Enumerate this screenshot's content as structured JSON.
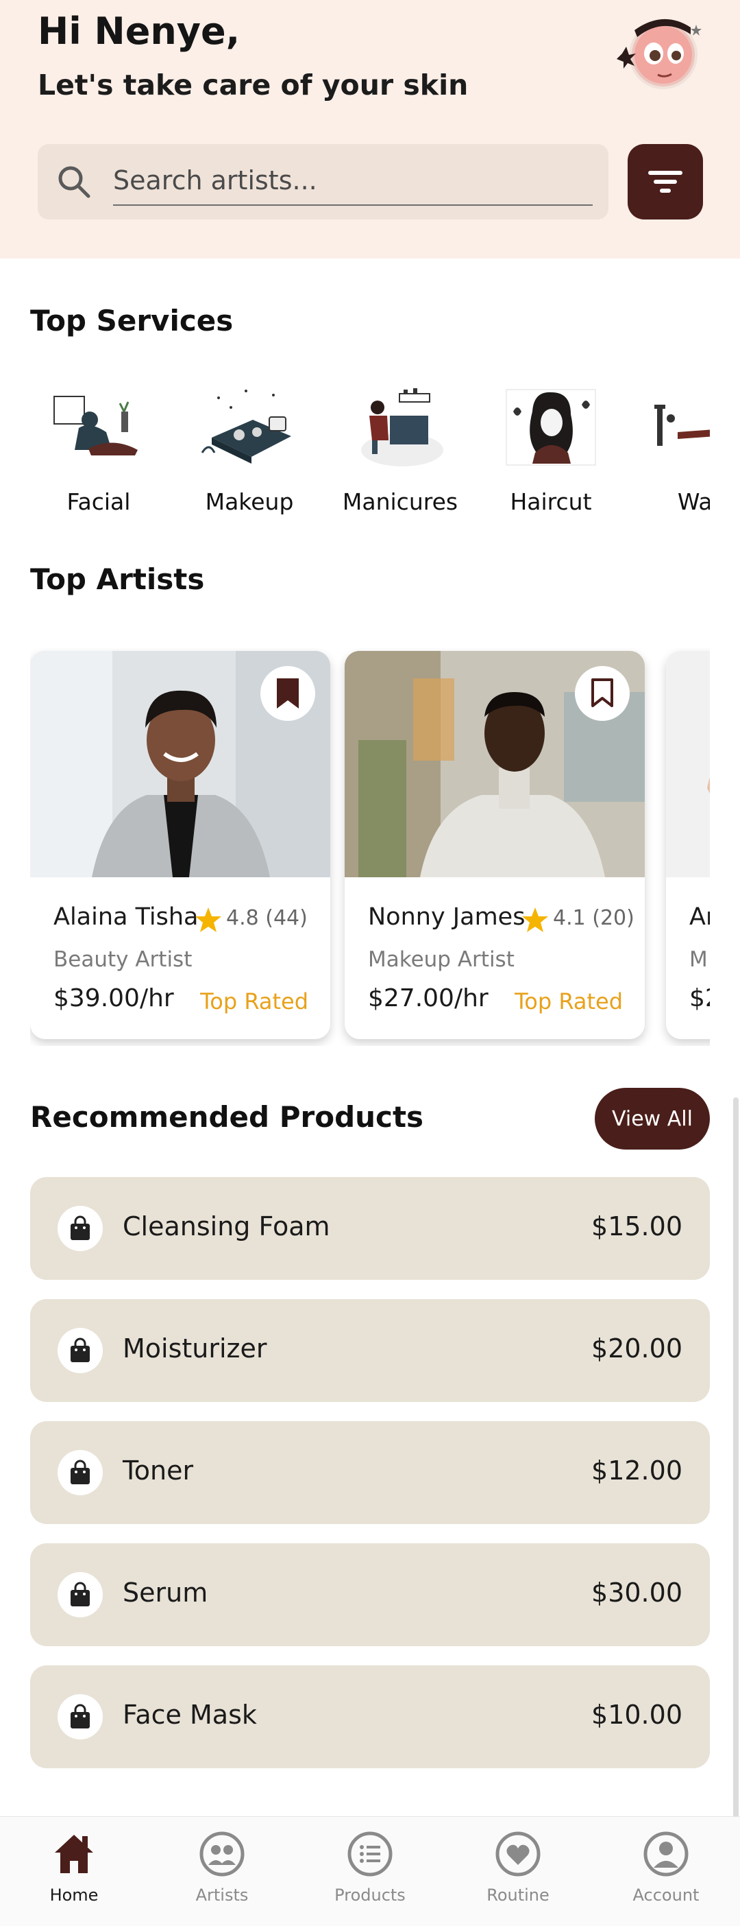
{
  "header": {
    "greeting": "Hi Nenye,",
    "tagline": "Let's take care of your skin",
    "search_placeholder": "Search artists..."
  },
  "services": {
    "title": "Top Services",
    "items": [
      {
        "label": "Facial",
        "icon": "facial-illustration"
      },
      {
        "label": "Makeup",
        "icon": "makeup-illustration"
      },
      {
        "label": "Manicures",
        "icon": "manicure-illustration"
      },
      {
        "label": "Haircut",
        "icon": "haircut-illustration"
      },
      {
        "label": "Wax",
        "icon": "wax-illustration"
      }
    ]
  },
  "artists": {
    "title": "Top Artists",
    "items": [
      {
        "name": "Alaina Tisha",
        "rating": "4.8",
        "reviews": "(44)",
        "role": "Beauty Artist",
        "price": "$39.00/hr",
        "badge": "Top Rated",
        "bookmarked": true
      },
      {
        "name": "Nonny James",
        "rating": "4.1",
        "reviews": "(20)",
        "role": "Makeup Artist",
        "price": "$27.00/hr",
        "badge": "Top Rated",
        "bookmarked": false
      },
      {
        "name": "Ar",
        "role": "M",
        "price": "$2"
      }
    ]
  },
  "products": {
    "title": "Recommended Products",
    "view_all": "View All",
    "items": [
      {
        "name": "Cleansing Foam",
        "price": "$15.00"
      },
      {
        "name": "Moisturizer",
        "price": "$20.00"
      },
      {
        "name": "Toner",
        "price": "$12.00"
      },
      {
        "name": "Serum",
        "price": "$30.00"
      },
      {
        "name": "Face Mask",
        "price": "$10.00"
      }
    ]
  },
  "nav": {
    "items": [
      {
        "label": "Home",
        "icon": "home-icon",
        "active": true
      },
      {
        "label": "Artists",
        "icon": "artists-icon"
      },
      {
        "label": "Products",
        "icon": "products-icon"
      },
      {
        "label": "Routine",
        "icon": "routine-icon"
      },
      {
        "label": "Account",
        "icon": "account-icon"
      }
    ]
  },
  "colors": {
    "brand": "#4a1e1a",
    "header_bg": "#fcefe8",
    "product_bg": "#e8e2d6",
    "accent": "#e8a11b"
  }
}
